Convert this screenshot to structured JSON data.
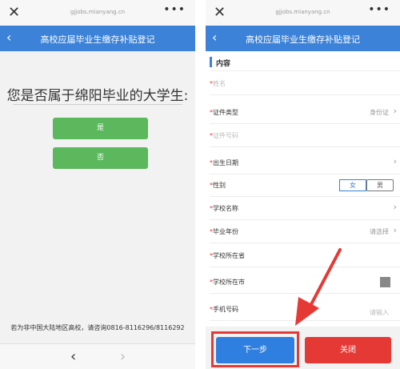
{
  "browser": {
    "close_glyph": "✕",
    "url": "gjjobs.mianyang.cn",
    "more_glyph": "•••"
  },
  "header": {
    "back_glyph": "‹",
    "title": "高校应届毕业生缴存补贴登记"
  },
  "left": {
    "question": "您是否属于绵阳毕业的大学生:",
    "yes_label": "是",
    "no_label": "否",
    "footnote": "若为非中国大陆地区高校，请咨询0816-8116296/8116292",
    "nav": {
      "prev": "‹",
      "next": "›"
    }
  },
  "right": {
    "section_title": "内容",
    "rows": [
      {
        "label": "姓名"
      },
      {
        "label": "证件类型",
        "value": "身份证"
      },
      {
        "label": "证件号码"
      },
      {
        "label": "出生日期"
      },
      {
        "label": "性别",
        "options": [
          "女",
          "男"
        ]
      },
      {
        "label": "学校名称"
      },
      {
        "label": "毕业年份",
        "value": "请选择"
      },
      {
        "label": "学校所在省"
      },
      {
        "label": "学校所在市"
      },
      {
        "label": "手机号码",
        "value": "请输入"
      }
    ],
    "required_mark": "*",
    "chevron_glyph": "›",
    "next_label": "下一步",
    "close_label": "关闭"
  },
  "colors": {
    "accent": "#3b82d8",
    "green": "#5cb85c",
    "danger": "#e53935"
  }
}
